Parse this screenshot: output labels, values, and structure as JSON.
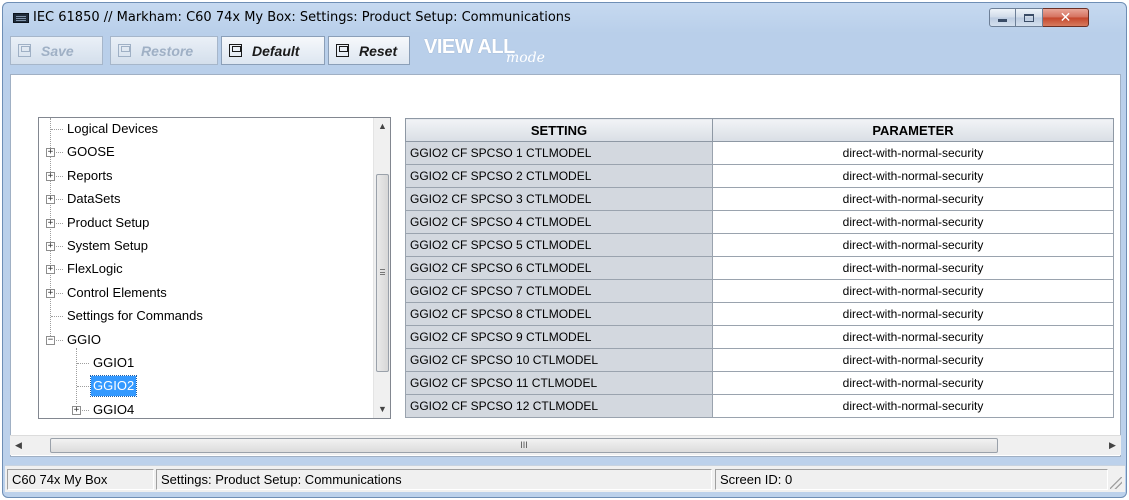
{
  "window": {
    "title": "IEC 61850 // Markham: C60 74x My Box: Settings: Product Setup: Communications",
    "minimize_icon": "minimize-icon",
    "maximize_icon": "maximize-icon",
    "close_glyph": "✕"
  },
  "toolbar": {
    "save_label": "Save",
    "restore_label": "Restore",
    "default_label": "Default",
    "reset_label": "Reset",
    "view_all_big": "VIEW ALL",
    "view_all_small": "mode"
  },
  "tree": {
    "items": [
      {
        "label": "Logical Devices",
        "expander": ""
      },
      {
        "label": "GOOSE",
        "expander": "+"
      },
      {
        "label": "Reports",
        "expander": "+"
      },
      {
        "label": "DataSets",
        "expander": "+"
      },
      {
        "label": "Product Setup",
        "expander": "+"
      },
      {
        "label": "System Setup",
        "expander": "+"
      },
      {
        "label": "FlexLogic",
        "expander": "+"
      },
      {
        "label": "Control Elements",
        "expander": "+"
      },
      {
        "label": "Settings for Commands",
        "expander": ""
      },
      {
        "label": "GGIO",
        "expander": "−"
      },
      {
        "label": "GGIO1",
        "expander": ""
      },
      {
        "label": "GGIO2",
        "expander": "",
        "selected": true
      },
      {
        "label": "GGIO4",
        "expander": "+"
      }
    ]
  },
  "table": {
    "headers": [
      "SETTING",
      "PARAMETER"
    ],
    "rows": [
      [
        "GGIO2 CF SPCSO 1 CTLMODEL",
        "direct-with-normal-security"
      ],
      [
        "GGIO2 CF SPCSO 2 CTLMODEL",
        "direct-with-normal-security"
      ],
      [
        "GGIO2 CF SPCSO 3 CTLMODEL",
        "direct-with-normal-security"
      ],
      [
        "GGIO2 CF SPCSO 4 CTLMODEL",
        "direct-with-normal-security"
      ],
      [
        "GGIO2 CF SPCSO 5 CTLMODEL",
        "direct-with-normal-security"
      ],
      [
        "GGIO2 CF SPCSO 6 CTLMODEL",
        "direct-with-normal-security"
      ],
      [
        "GGIO2 CF SPCSO 7 CTLMODEL",
        "direct-with-normal-security"
      ],
      [
        "GGIO2 CF SPCSO 8 CTLMODEL",
        "direct-with-normal-security"
      ],
      [
        "GGIO2 CF SPCSO 9 CTLMODEL",
        "direct-with-normal-security"
      ],
      [
        "GGIO2 CF SPCSO 10 CTLMODEL",
        "direct-with-normal-security"
      ],
      [
        "GGIO2 CF SPCSO 11 CTLMODEL",
        "direct-with-normal-security"
      ],
      [
        "GGIO2 CF SPCSO 12 CTLMODEL",
        "direct-with-normal-security"
      ]
    ]
  },
  "hscroll": {
    "grip": "III",
    "left_arrow": "◀",
    "right_arrow": "▶"
  },
  "vscroll": {
    "up_arrow": "▲",
    "down_arrow": "▼"
  },
  "statusbar": {
    "device": "C60 74x My Box",
    "path": "Settings: Product Setup: Communications",
    "screen_id": "Screen ID: 0"
  },
  "colors": {
    "window_bg": "#bcd1eb",
    "selection": "#3399ff",
    "setting_cell_bg": "#d3d8df",
    "close_button": "#c4452b"
  }
}
